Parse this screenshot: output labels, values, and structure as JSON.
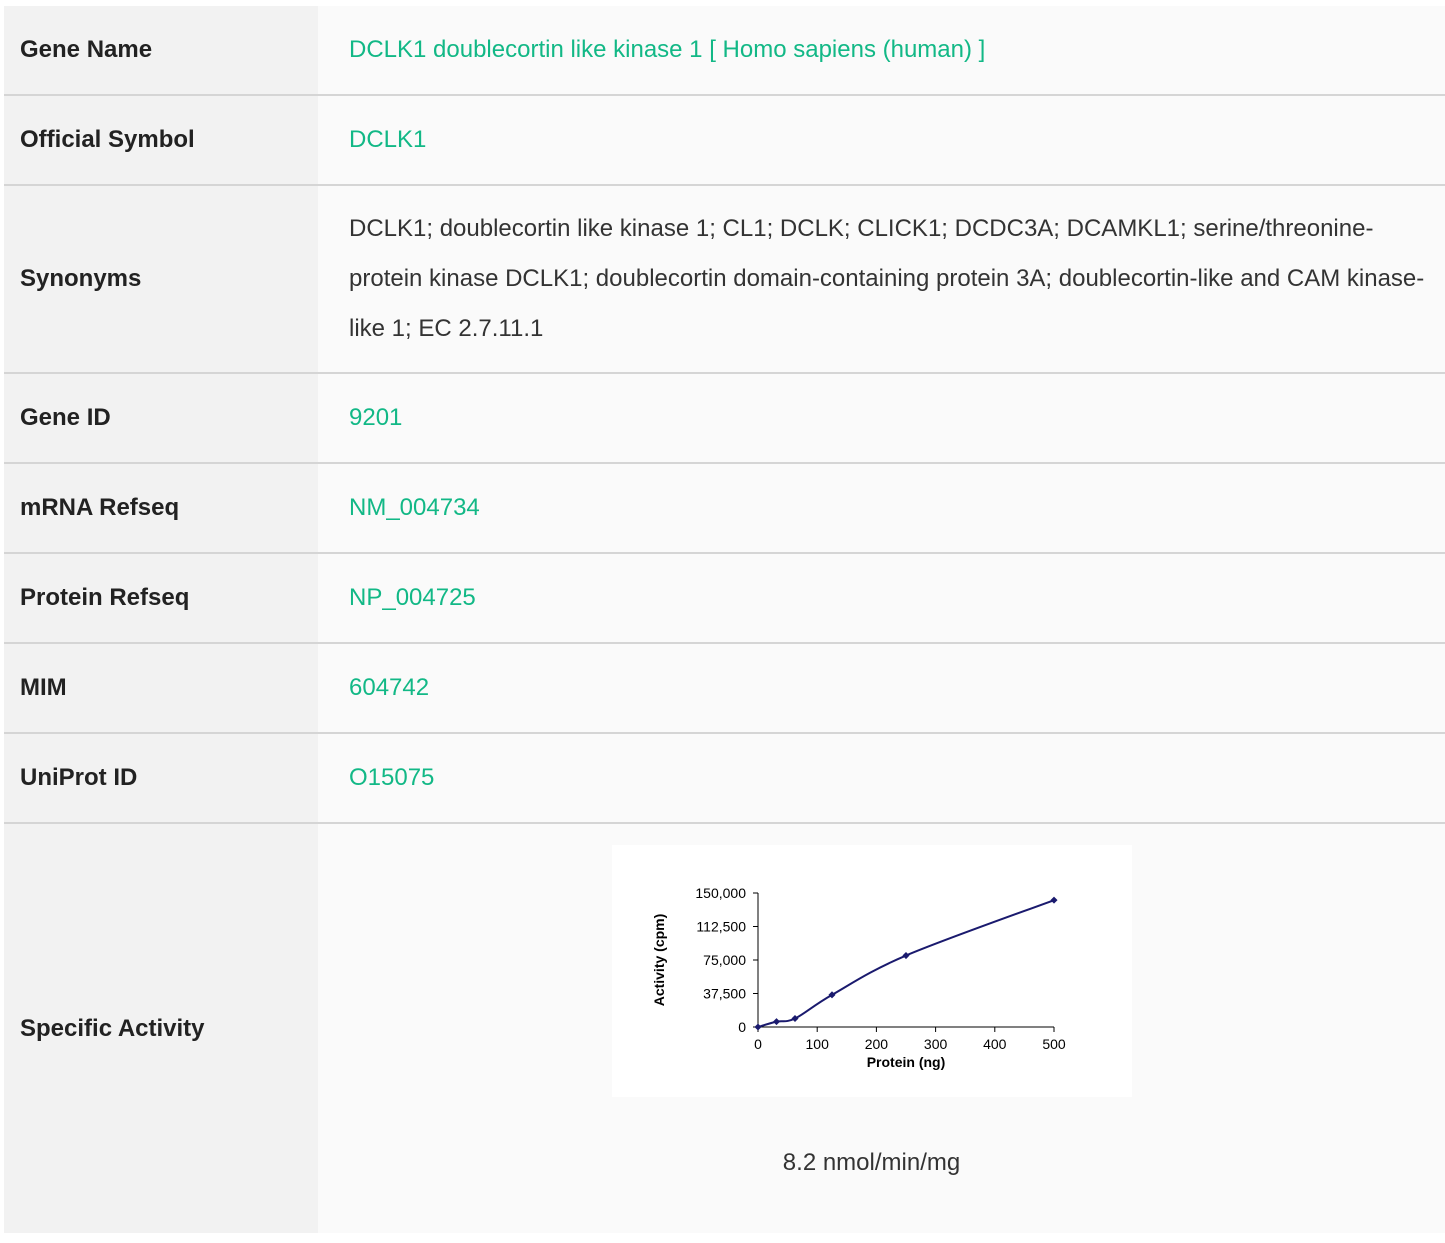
{
  "rows": [
    {
      "label": "Gene Name",
      "value": "DCLK1 doublecortin like kinase 1 [ Homo sapiens (human) ]"
    },
    {
      "label": "Official Symbol",
      "value": "DCLK1"
    },
    {
      "label": "Synonyms",
      "value": "DCLK1; doublecortin like kinase 1; CL1; DCLK; CLICK1; DCDC3A; DCAMKL1; serine/threonine-protein kinase DCLK1; doublecortin domain-containing protein 3A; doublecortin-like and CAM kinase-like 1; EC 2.7.11.1"
    },
    {
      "label": "Gene ID",
      "value": "9201"
    },
    {
      "label": "mRNA Refseq",
      "value": "NM_004734"
    },
    {
      "label": "Protein Refseq",
      "value": "NP_004725"
    },
    {
      "label": "MIM",
      "value": "604742"
    },
    {
      "label": "UniProt ID",
      "value": "O15075"
    },
    {
      "label": "Specific Activity",
      "value": "8.2 nmol/min/mg"
    }
  ],
  "colors": {
    "link": "#12b886",
    "label_bg": "#f2f2f2",
    "value_bg": "#fafafa",
    "divider": "#d5d5d5",
    "series": "#1a1a6e"
  },
  "chart_data": {
    "type": "line",
    "title": "",
    "xlabel": "Protein (ng)",
    "ylabel": "Activity (cpm)",
    "xlim": [
      0,
      500
    ],
    "ylim": [
      0,
      150000
    ],
    "x_ticks": [
      "0",
      "100",
      "200",
      "300",
      "400",
      "500"
    ],
    "y_ticks": [
      "0",
      "37,500",
      "75,000",
      "112,500",
      "150,000"
    ],
    "grid": false,
    "series": [
      {
        "x": [
          0,
          31.25,
          62.5,
          125,
          250,
          500
        ],
        "y": [
          0,
          6000,
          9500,
          36000,
          80000,
          142000
        ]
      }
    ]
  }
}
